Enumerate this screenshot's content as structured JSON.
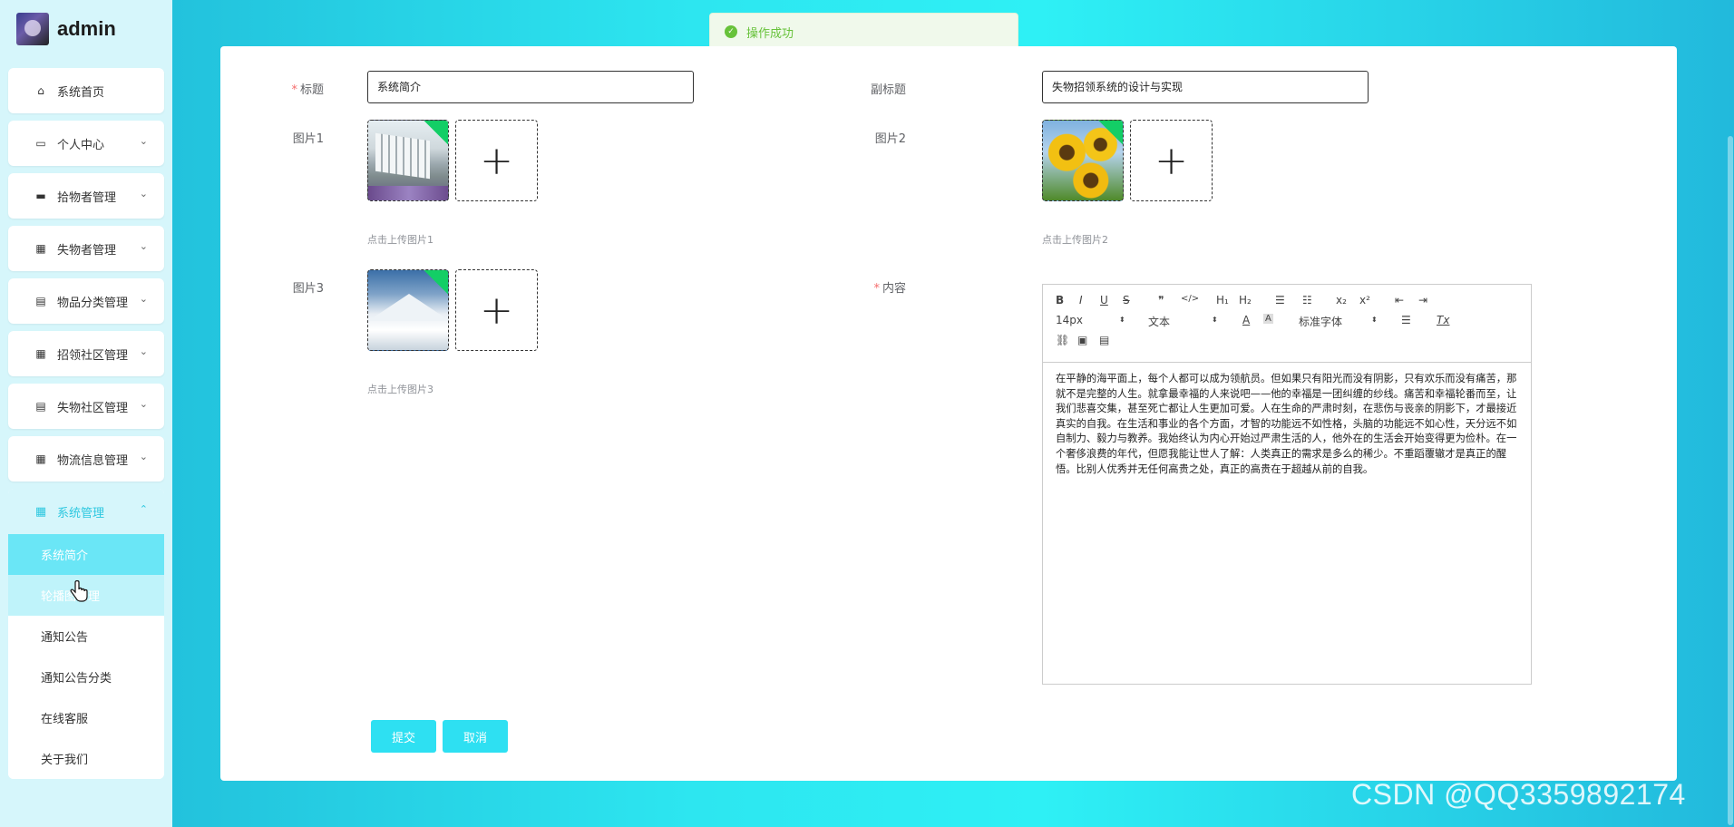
{
  "brand": {
    "name": "admin"
  },
  "sidebar": {
    "items": [
      {
        "label": "系统首页",
        "icon": "home-icon",
        "glyph": "⌂",
        "arrow": ""
      },
      {
        "label": "个人中心",
        "icon": "id-card-icon",
        "glyph": "▭",
        "arrow": "⌄"
      },
      {
        "label": "拾物者管理",
        "icon": "briefcase-icon",
        "glyph": "▬",
        "arrow": "⌄"
      },
      {
        "label": "失物者管理",
        "icon": "grid-icon",
        "glyph": "▦",
        "arrow": "⌄"
      },
      {
        "label": "物品分类管理",
        "icon": "clipboard-icon",
        "glyph": "▤",
        "arrow": "⌄"
      },
      {
        "label": "招领社区管理",
        "icon": "grid-icon",
        "glyph": "▦",
        "arrow": "⌄"
      },
      {
        "label": "失物社区管理",
        "icon": "clipboard-icon",
        "glyph": "▤",
        "arrow": "⌄"
      },
      {
        "label": "物流信息管理",
        "icon": "grid-icon",
        "glyph": "▦",
        "arrow": "⌄"
      }
    ],
    "system_group": {
      "label": "系统管理",
      "glyph": "▦",
      "arrow": "⌃",
      "subitems": [
        "系统简介",
        "轮播图管理",
        "通知公告",
        "通知公告分类",
        "在线客服",
        "关于我们"
      ]
    }
  },
  "toast": {
    "text": "操作成功",
    "icon_glyph": "✓"
  },
  "form": {
    "title_label": "标题",
    "title_value": "系统简介",
    "subtitle_label": "副标题",
    "subtitle_value": "失物招领系统的设计与实现",
    "image1_label": "图片1",
    "image1_hint": "点击上传图片1",
    "image2_label": "图片2",
    "image2_hint": "点击上传图片2",
    "image3_label": "图片3",
    "image3_hint": "点击上传图片3",
    "content_label": "内容",
    "upload_plus": "+"
  },
  "editor": {
    "tools": {
      "bold": "B",
      "italic": "I",
      "underline": "U",
      "strike": "S",
      "quote": "❞",
      "code": "</>",
      "h1": "H₁",
      "h2": "H₂",
      "ordered_list": "☰",
      "bullet_list": "☷",
      "subscript": "x₂",
      "superscript": "x²",
      "outdent": "⇤",
      "indent": "⇥",
      "font_size": "14px",
      "text_style": "文本",
      "font_color": "A",
      "bg_color": "A",
      "font_family": "标准字体",
      "align": "☰",
      "clear": "Tx",
      "link": "⛓",
      "image": "▣",
      "video": "▤",
      "caret": "⬍"
    },
    "content": "在平静的海平面上，每个人都可以成为领航员。但如果只有阳光而没有阴影，只有欢乐而没有痛苦，那就不是完整的人生。就拿最幸福的人来说吧——他的幸福是一团纠缠的纱线。痛苦和幸福轮番而至，让我们悲喜交集，甚至死亡都让人生更加可爱。人在生命的严肃时刻，在悲伤与丧亲的阴影下，才最接近真实的自我。在生活和事业的各个方面，才智的功能远不如性格，头脑的功能远不如心性，天分远不如自制力、毅力与教养。我始终认为内心开始过严肃生活的人，他外在的生活会开始变得更为俭朴。在一个奢侈浪费的年代，但愿我能让世人了解：人类真正的需求是多么的稀少。不重蹈覆辙才是真正的醒悟。比别人优秀并无任何高贵之处，真正的高贵在于超越从前的自我。"
  },
  "buttons": {
    "submit": "提交",
    "cancel": "取消"
  },
  "watermark": "CSDN @QQ3359892174",
  "colors": {
    "accent": "#2ee0f2",
    "success": "#67c23a",
    "sidebar_bg": "#d6f6fb"
  }
}
